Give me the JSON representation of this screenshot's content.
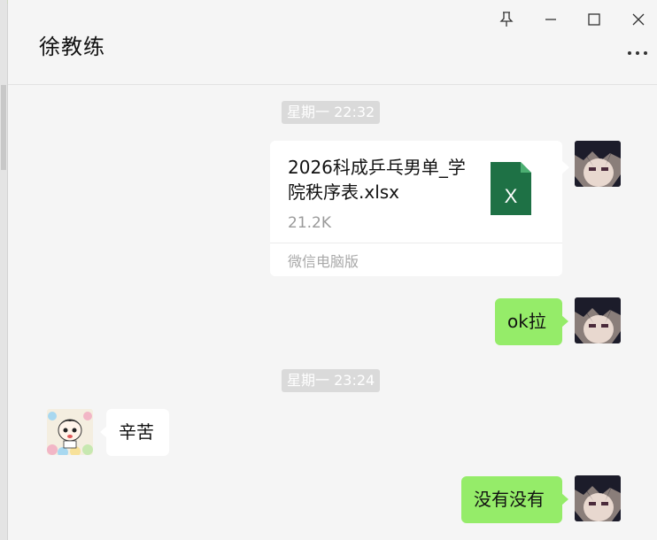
{
  "window": {
    "title": "徐教练",
    "buttons": [
      "pin",
      "minimize",
      "maximize",
      "close"
    ]
  },
  "header": {
    "more_label": "more-options"
  },
  "messages": [
    {
      "type": "time",
      "text": "星期一 22:32"
    },
    {
      "type": "file",
      "sender": "self",
      "file_name": "2026科成乒乓男单_学院秩序表.xlsx",
      "file_size": "21.2K",
      "source": "微信电脑版",
      "icon": "excel-file-icon"
    },
    {
      "type": "text",
      "sender": "self",
      "text": "ok拉"
    },
    {
      "type": "time",
      "text": "星期一 23:24"
    },
    {
      "type": "text",
      "sender": "other",
      "text": "辛苦"
    },
    {
      "type": "text",
      "sender": "self",
      "text": "没有没有"
    }
  ],
  "colors": {
    "self_bubble": "#95ec69",
    "other_bubble": "#ffffff",
    "background": "#f5f5f5",
    "excel_green": "#1e7145"
  }
}
